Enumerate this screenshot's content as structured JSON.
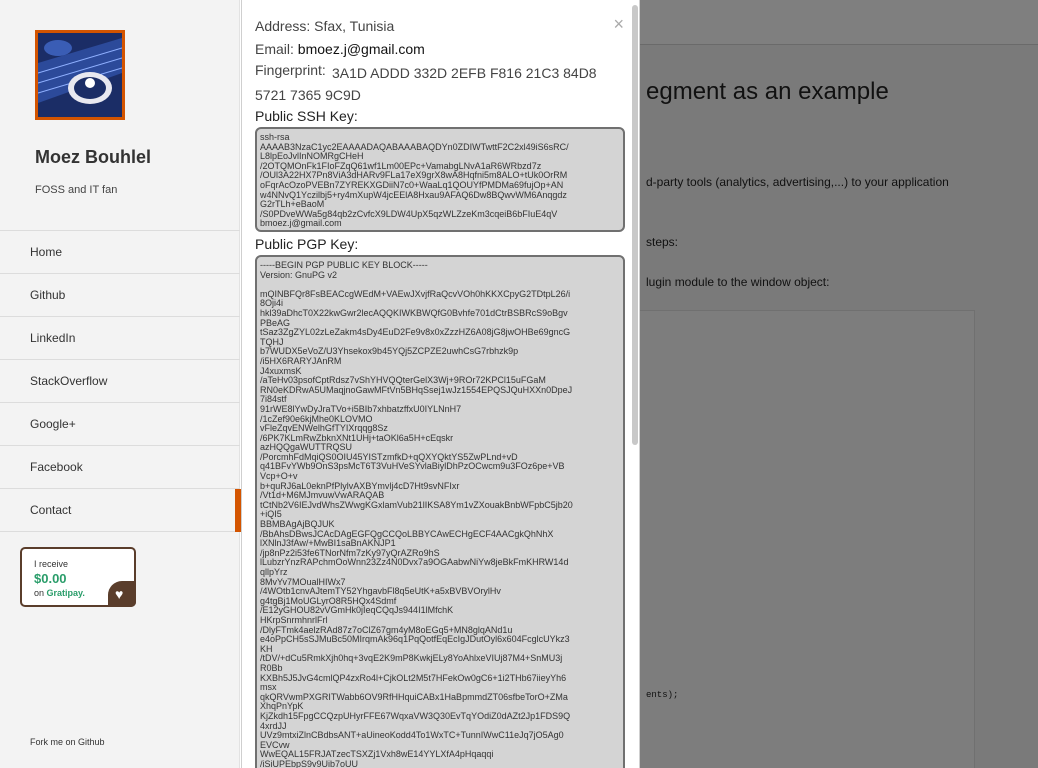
{
  "profile": {
    "name": "Moez Bouhlel",
    "tagline": "FOSS and IT fan",
    "avatar_icon": "penguin-keyboard-icon"
  },
  "sidebar": {
    "items": [
      {
        "label": "Home"
      },
      {
        "label": "Github"
      },
      {
        "label": "LinkedIn"
      },
      {
        "label": "StackOverflow"
      },
      {
        "label": "Google+"
      },
      {
        "label": "Facebook"
      },
      {
        "label": "Contact",
        "active": true
      }
    ],
    "active_color": "#d35400",
    "fork_label": "Fork me on Github"
  },
  "gratipay": {
    "line1": "I receive",
    "amount": "$0.00",
    "on": "on",
    "brand": "Gratipay.",
    "icon": "heart-icon"
  },
  "modal": {
    "close_symbol": "×",
    "address_label": "Address:",
    "address_value": "Sfax, Tunisia",
    "email_label": "Email:",
    "email_value": "bmoez.j@gmail.com",
    "fingerprint_label": "Fingerprint:",
    "fingerprint_value": "3A1D ADDD 332D 2EFB F816 21C3 84D8 5721 7365 9C9D",
    "ssh_label": "Public SSH Key:",
    "ssh_key": "ssh-rsa\nAAAAB3NzaC1yc2EAAAADAQABAAABAQDYn0ZDIWTwttF2C2xl49iS6sRC/\nL8lpEoJvlInNOMRgCHeH\n/2OTQMOnFk1FIoFZqQ61wf1Lm00EPc+VamabgLNvA1aR6WRbzd7z\n/OUl3A22HX7Pn8ViA3dHARv9FLa17eX9grX8wA8Hqfni5m8ALO+tUk0OrRM\noFqrAcOzoPVEBn7ZYREKXGDiiN7c0+WaaLq1QOUYfPMDMa69fujOp+AN\nw4NNvQ1Yczilbj5+ry4mXupW4jcEElA8Hxau9AFAQ6Dw8BQwvWM6Anqgdz\nG2rTLh+eBaoM\n/S0PDveWWa5g84qb2zCvfcX9LDW4UpX5qzWLZzeKm3cqeiB6bFIuE4qV\nbmoez.j@gmail.com",
    "pgp_label": "Public PGP Key:",
    "pgp_key": "-----BEGIN PGP PUBLIC KEY BLOCK-----\nVersion: GnuPG v2\n\nmQINBFQr8FsBEACcgWEdM+VAEwJXvjfRaQcvVOh0hKKXCpyG2TDtpL26/i\n8Oji4i\nhkl39aDhcT0X22kwGwr2lecAQQKIWKBWQfG0Bvhfe701dCtrBSBRcS9oBgv\nPBeAG\ntSaz3ZgZYL02zLeZakm4sDy4EuD2Fe9v8x0xZzzHZ6A08jG8jwOHBe69gncG\nTQHJ\nb7WUDX5eVoZ/U3Yhsekox9b45YQj5ZCPZE2uwhCsG7rbhzk9p\n/i5HX6RARYJAnRM\nJ4xuxmsK\n/aTeHv03psofCptRdsz7vShYHVQQterGelX3Wj+9ROr72KPCl15uFGaM\nRN0eKDRwA5UMaqjnoGawMFtVn5BHqSsej1wJz1554EPQSJQuHXXn0DpeJ\n7i84stf\n91rWE8lYwDyJraTVo+i5BIb7xhbatzffxU0IYLNnH7\n/1cZef90e6kjMhe0KLOVMO\nvFleZqvENWelhGfTYIXrqqg8Sz\n/6PK7KLmRwZbknXNt1UHj+taOKl6a5H+cEqskr\nazHQQgaWUTTRQSU\n/PorcmhFdMqiQS0OIU45YISTzmfkD+qQXYQktYS5ZwPLnd+vD\nq41BFvYWb9OnS3psMcT6T3VuHVeSYvlaBiylDhPzOCwcm9u3FOz6pe+VB\nVcp+O+v\nb+quRJ6aL0eknPfPlylvAXBYmvlj4cD7Ht9svNFIxr\n/Vt1d+M6MJmvuwVwARAQAB\ntCtNb2V6IEJvdWhsZWwgKGxlamVub21lIKSA8Ym1vZXouakBnbWFpbC5jb20\n+iQI5\nBBMBAgAjBQJUK\n/BbAhsDBwsJCAcDAgEGFQgCCQoLBBYCAwECHgECF4AACgkQhNhX\nlXNlnJ3fAw/+MwBI1saBnAKNJP1\n/jp8nPz2i53fe6TNorNfm7zKy97yQrAZRo9hS\nlLubzrYnzRAPchmOoWnn23Zz4N0Dvx7a9OGAabwNiYw8jeBkFmKHRW14d\nqllpYrz\n8MvYv7MOualHIWx7\n/4WOtb1cnvAJtemTY52YhgavbFl8q5eUtK+a5xBVBVOrylHv\ng4tgBj1MoUGLyrO8R5HQx4Sdmf\n/E12yGHOU82vVGmHk0jIeqCQqJs944I1lMfchK\nHKrpSnrmhnrlFrl\n/DlyFTmk4aelzRAd87z7oClZ67gm4yM8oEGq5+MN8glqANd1u\ne4oPpCH5sSJMuBc50MIrqmAk96q1PqQotfEqEcIgJDutOyl6x604FcglcUYkz3\nKH\n/tDV/+dCu5RmkXjh0hq+3vqE2K9mP8KwkjELy8YoAhlxeVIUj87M4+SnMU3j\nR0Bb\nKXBh5J5JvG4cmlQP4zxRo4l+CjkOLt2M5t7HFekOw0gC6+1i2THb67iieyYh6\nmsx\nqkQRVwmPXGRITWabb6OV9RfHHquiCABx1HaBpmmdZT06sfbeTorO+ZMa\nXhqPnYpK\nKjZkdh15FpgCCQzpUHyrFFE67WqxaVW3Q30EvTqYOdiZ0dAZt2Jp1FDS9Q\n4xrdJJ\nUVz9mtxiZlnCBdbsANT+aUineoKodd4To1WxTC+TunnIWwC11eJq7jO5Ag0\nEVCvw\nWwEQAL15FRJATzecTSXZj1Vxh8wE14YYLXfA4pHqaqqi\n/iSiUPEbpS9v9Uib7oUU"
  },
  "background": {
    "heading": "egment as an example",
    "p1": "d-party tools (analytics, advertising,...) to your application",
    "p2": "steps:",
    "p3": "lugin module to the window object:",
    "code_fragment": "ents);"
  }
}
